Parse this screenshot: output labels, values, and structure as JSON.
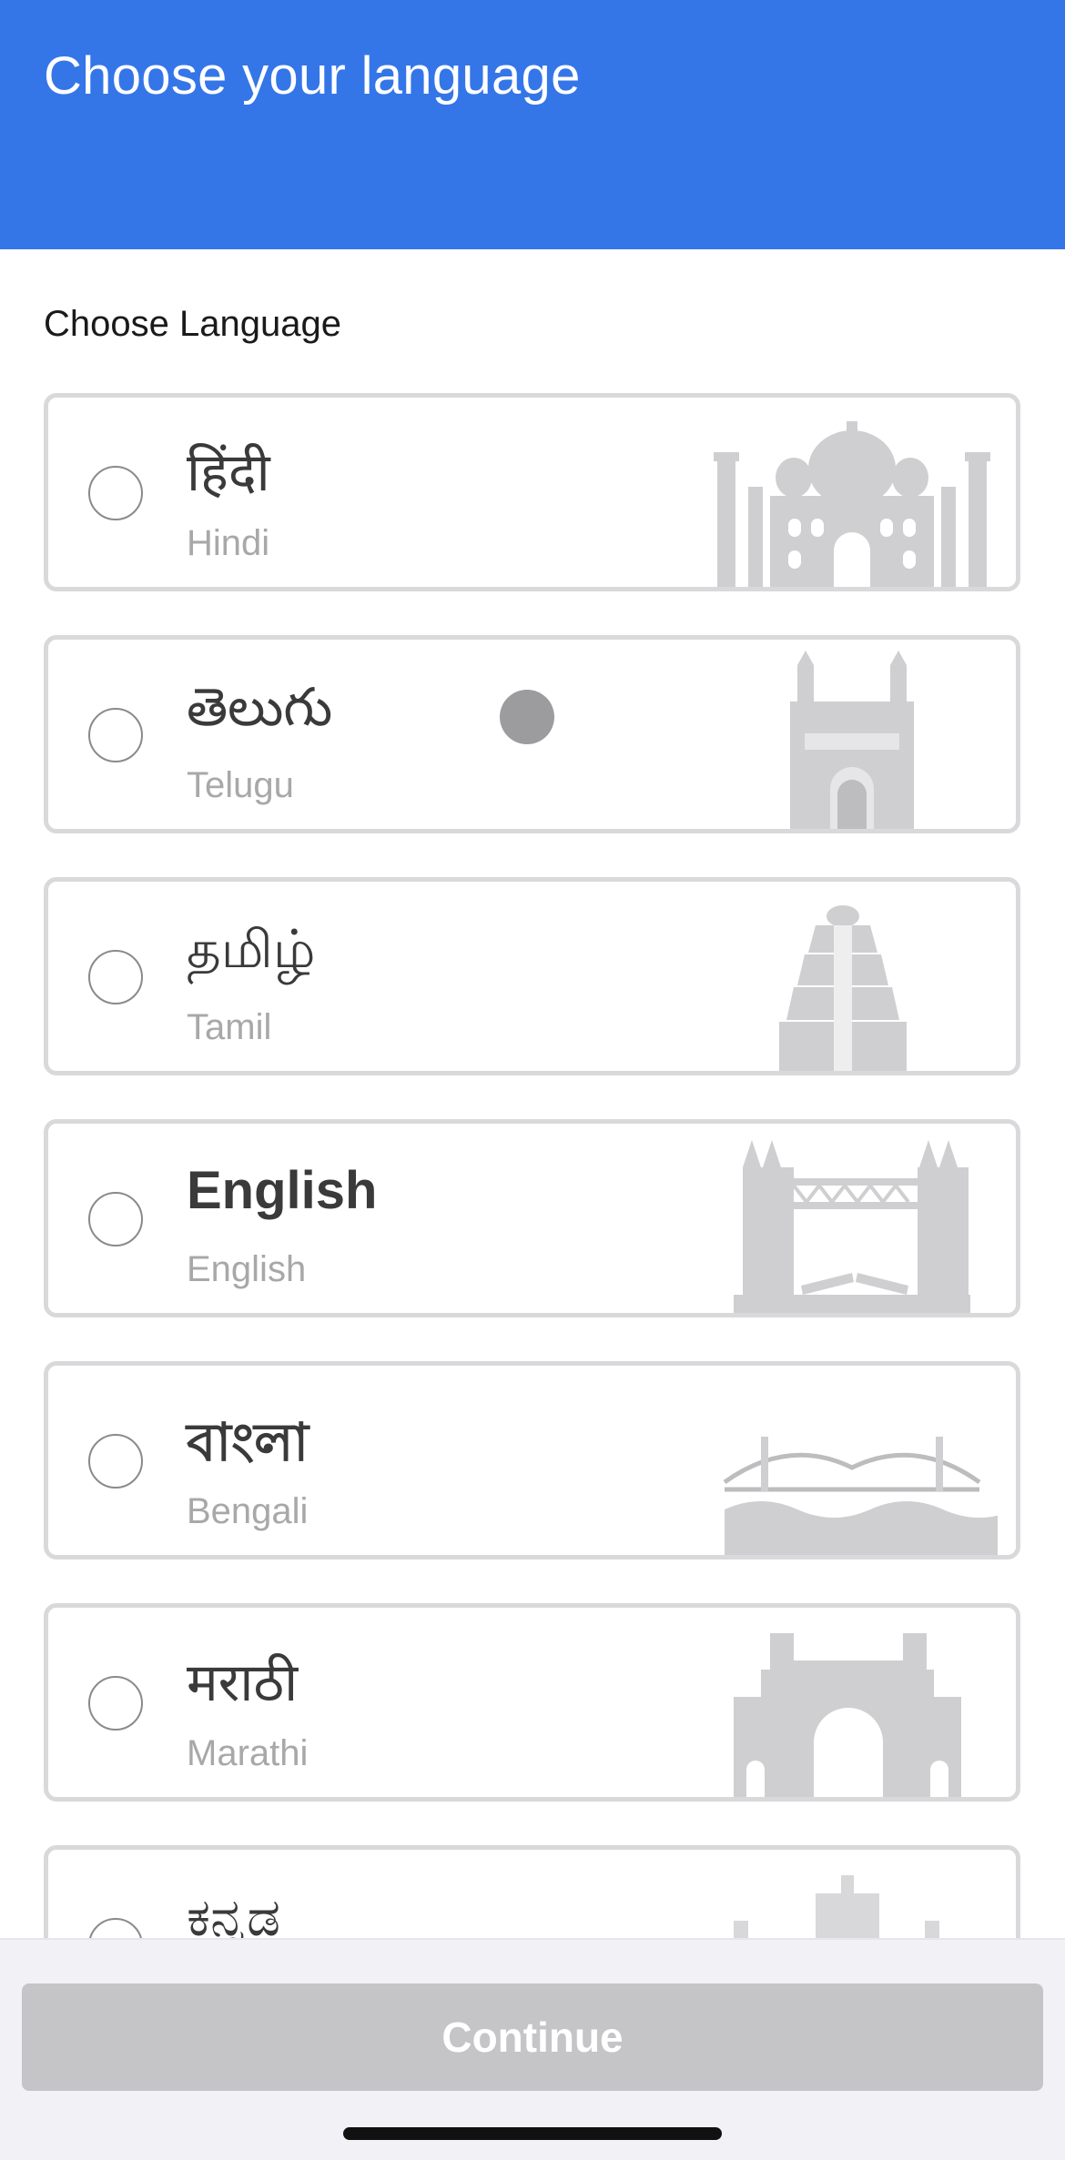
{
  "header": {
    "title": "Choose your language"
  },
  "section": {
    "label": "Choose Language"
  },
  "languages": [
    {
      "native": "हिंदी",
      "english": "Hindi",
      "monument": "taj-mahal-icon",
      "selected": false
    },
    {
      "native": "తెలుగు",
      "english": "Telugu",
      "monument": "charminar-icon",
      "selected": false
    },
    {
      "native": "தமிழ்",
      "english": "Tamil",
      "monument": "temple-gopuram-icon",
      "selected": false
    },
    {
      "native": "English",
      "english": "English",
      "monument": "tower-bridge-icon",
      "selected": false
    },
    {
      "native": "বাংলা",
      "english": "Bengali",
      "monument": "howrah-bridge-icon",
      "selected": false
    },
    {
      "native": "मराठी",
      "english": "Marathi",
      "monument": "gateway-of-india-icon",
      "selected": false
    },
    {
      "native": "ಕನ್ನಡ",
      "english": "",
      "monument": "vidhana-soudha-icon",
      "selected": false
    }
  ],
  "footer": {
    "continue_label": "Continue"
  },
  "colors": {
    "header_bg": "#3476e8",
    "card_border": "#d9d9dc",
    "button_disabled": "#c5c5c8",
    "monument_gray": "#cfcfd1"
  }
}
